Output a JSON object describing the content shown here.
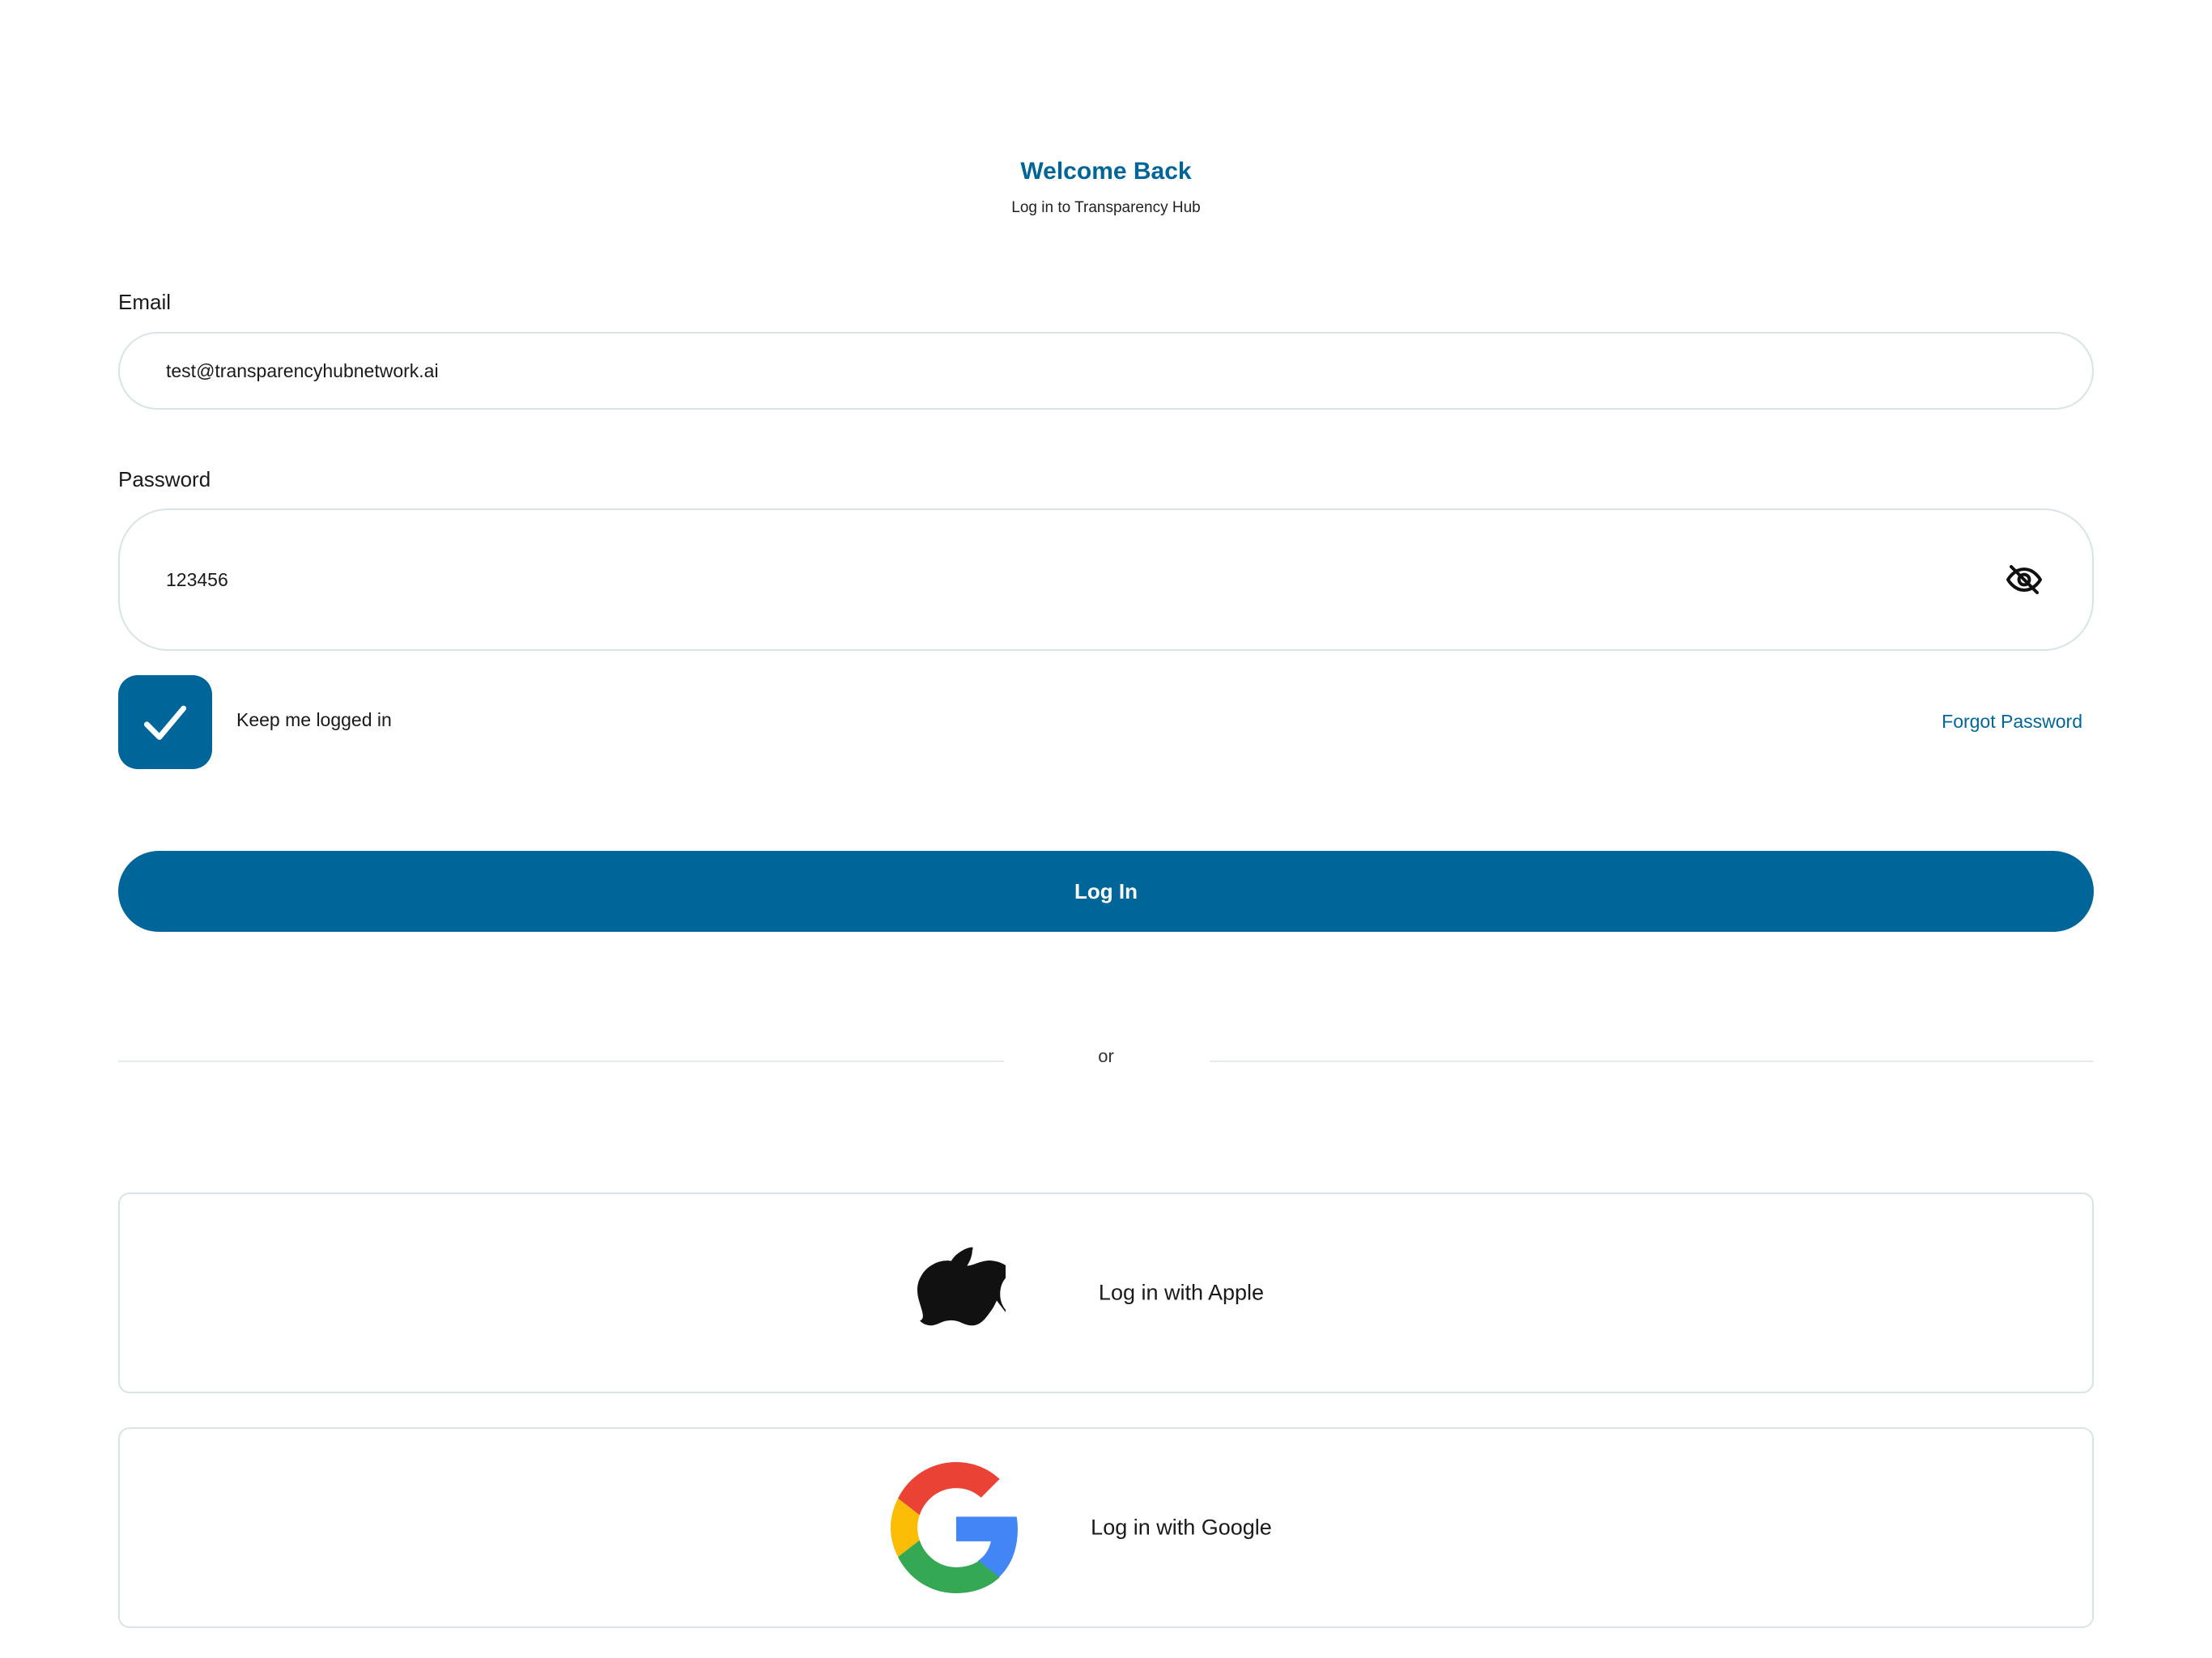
{
  "header": {
    "title": "Welcome Back",
    "subtitle": "Log in to Transparency Hub"
  },
  "form": {
    "email": {
      "label": "Email",
      "value": "test@transparencyhubnetwork.ai"
    },
    "password": {
      "label": "Password",
      "value": "123456",
      "visibility_icon": "eye-slash-icon"
    },
    "keep_logged_in": {
      "label": "Keep me logged in",
      "checked": true
    },
    "forgot_password_label": "Forgot Password",
    "submit_label": "Log In"
  },
  "divider": {
    "text": "or"
  },
  "social": {
    "apple_label": "Log in with Apple",
    "google_label": "Log in with Google"
  },
  "colors": {
    "primary": "#006699",
    "border": "#d8e4e6",
    "google_red": "#EA4335",
    "google_yellow": "#FBBC05",
    "google_green": "#34A853",
    "google_blue": "#4285F4"
  }
}
